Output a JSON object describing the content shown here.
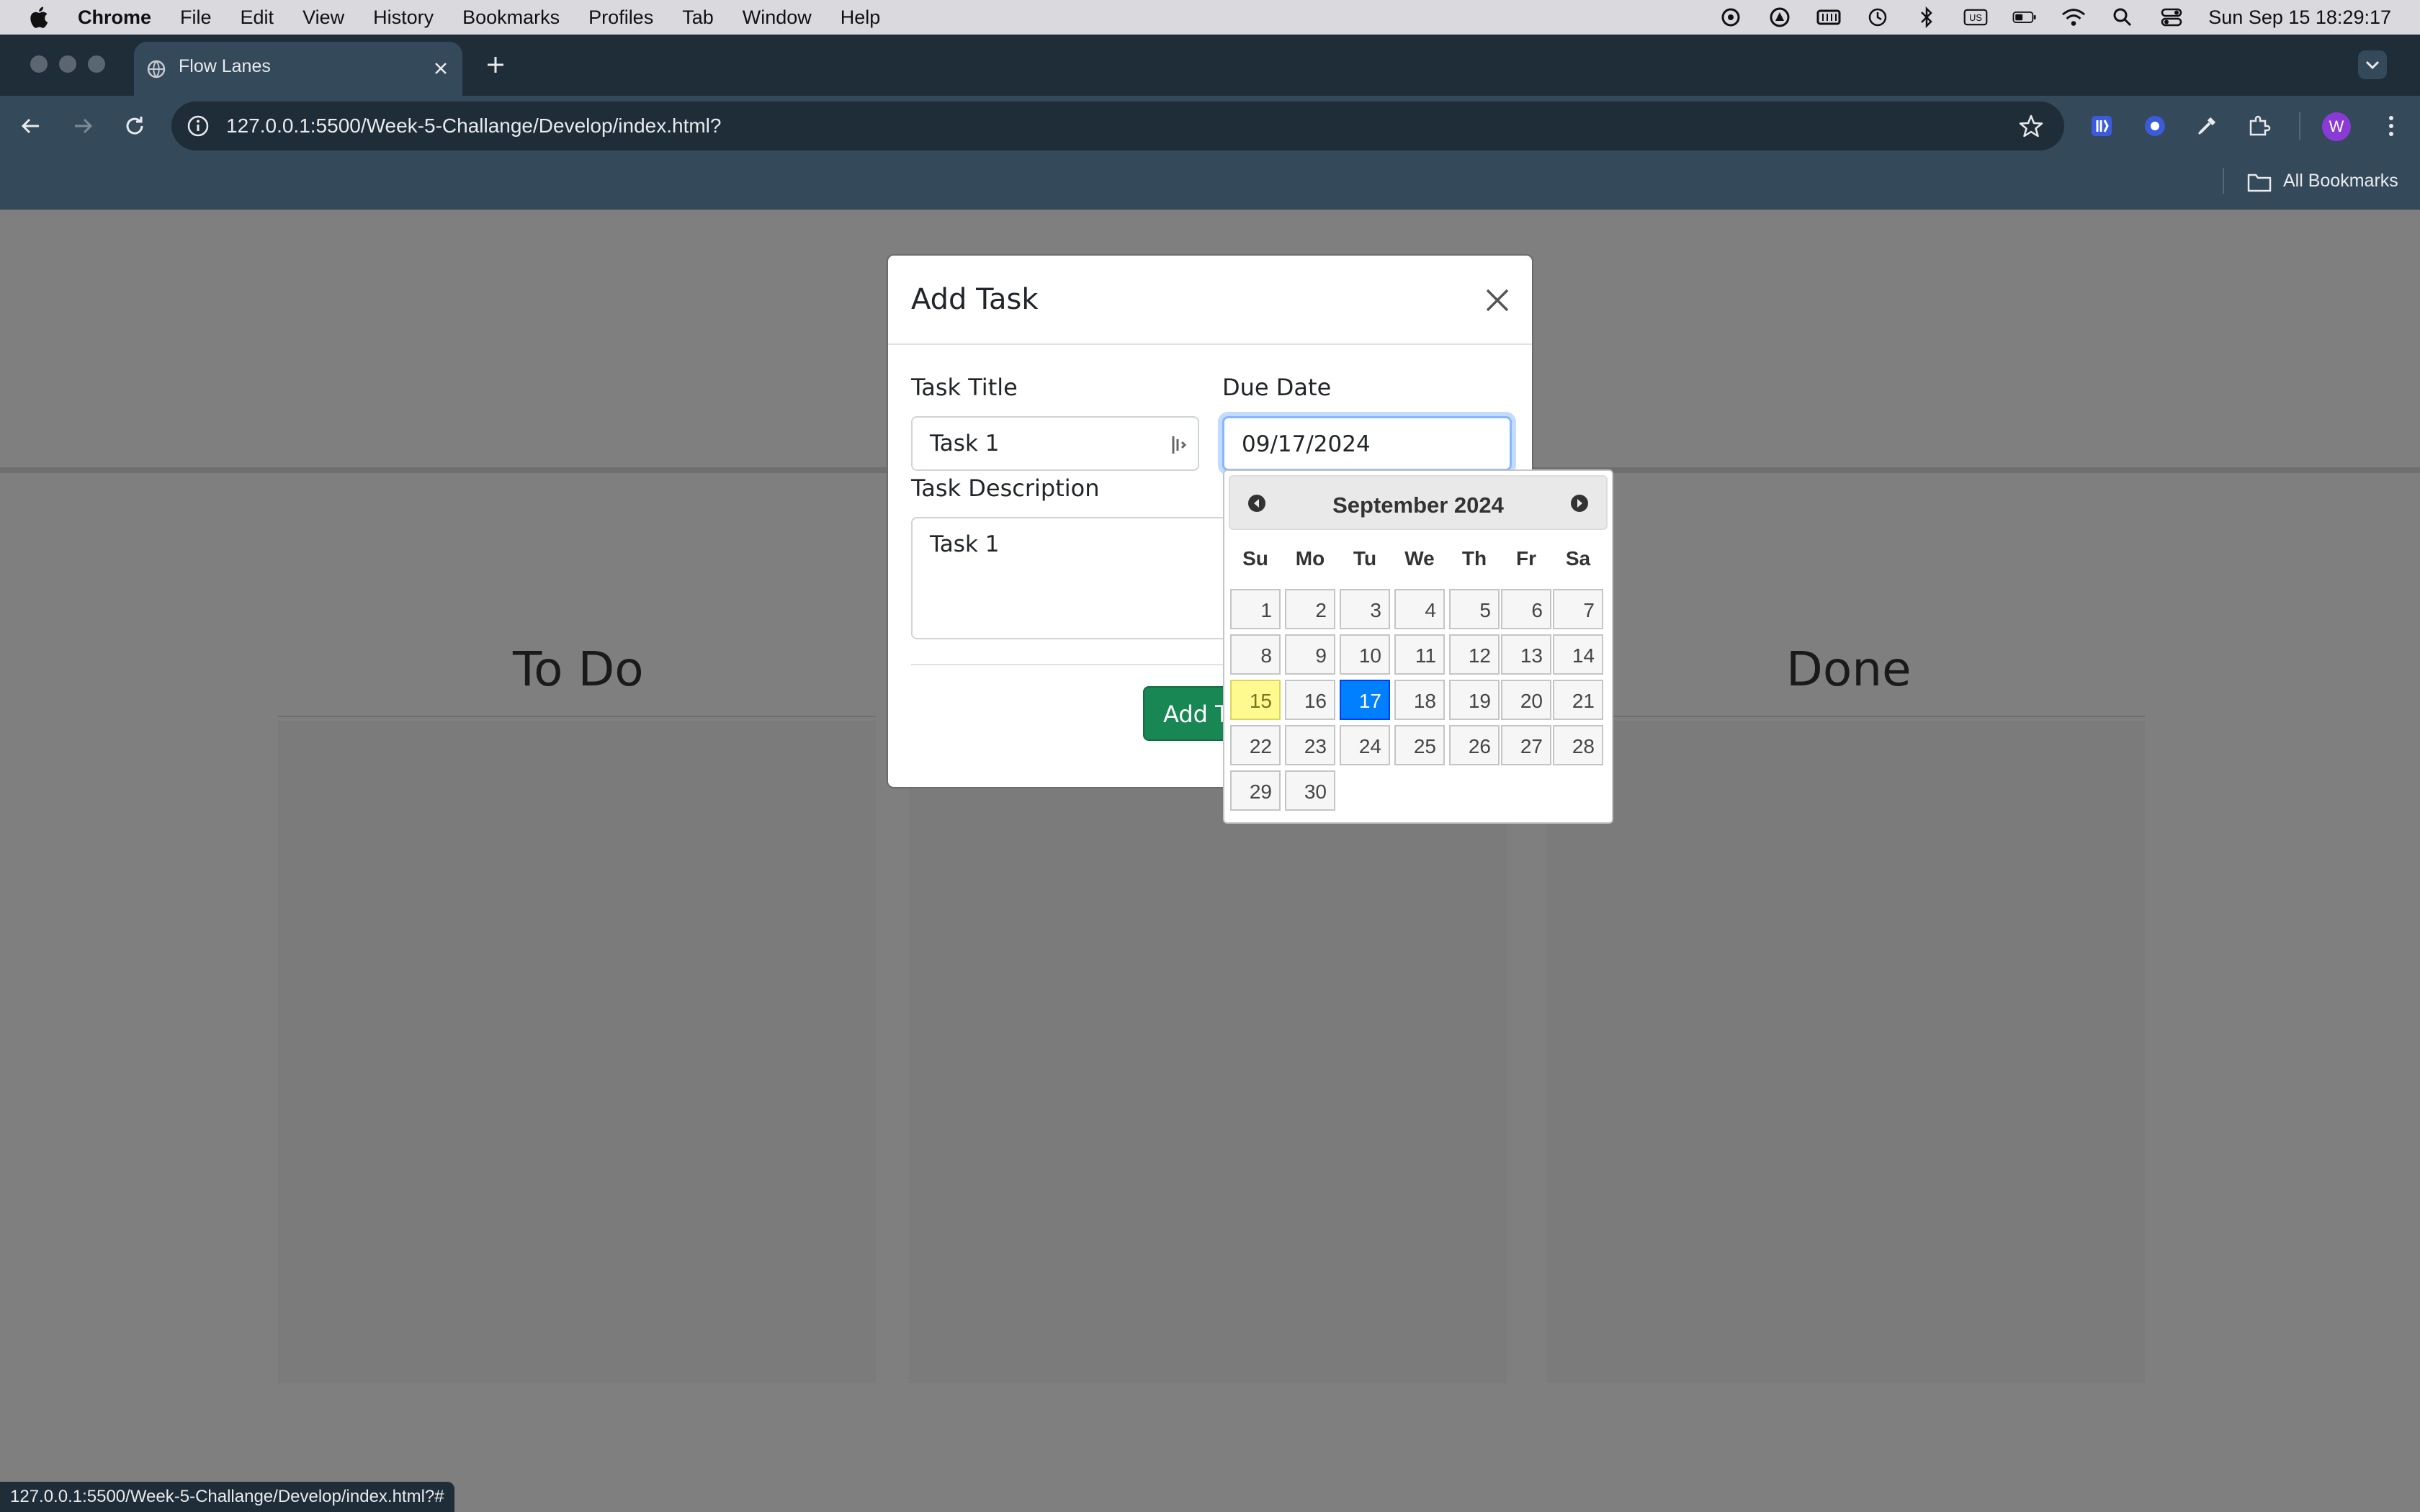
{
  "menubar": {
    "app": "Chrome",
    "items": [
      "File",
      "Edit",
      "View",
      "History",
      "Bookmarks",
      "Profiles",
      "Tab",
      "Window",
      "Help"
    ],
    "input_source": "US",
    "clock": "Sun Sep 15  18:29:17"
  },
  "browser": {
    "tab_title": "Flow Lanes",
    "url": "127.0.0.1:5500/Week-5-Challange/Develop/index.html?",
    "profile_initial": "W",
    "bookmarks_label": "All Bookmarks",
    "status_url": "127.0.0.1:5500/Week-5-Challange/Develop/index.html?#"
  },
  "page": {
    "lanes": [
      {
        "title": "To Do"
      },
      {
        "title": ""
      },
      {
        "title": "Done"
      }
    ]
  },
  "modal": {
    "title": "Add Task",
    "task_title_label": "Task Title",
    "task_title_value": "Task 1",
    "due_date_label": "Due Date",
    "due_date_value": "09/17/2024",
    "description_label": "Task Description",
    "description_value": "Task 1",
    "submit_label": "Add Task"
  },
  "datepicker": {
    "month_title": "September 2024",
    "weekdays": [
      "Su",
      "Mo",
      "Tu",
      "We",
      "Th",
      "Fr",
      "Sa"
    ],
    "first_weekday_index": 0,
    "days_in_month": 30,
    "today": 15,
    "selected": 17
  }
}
